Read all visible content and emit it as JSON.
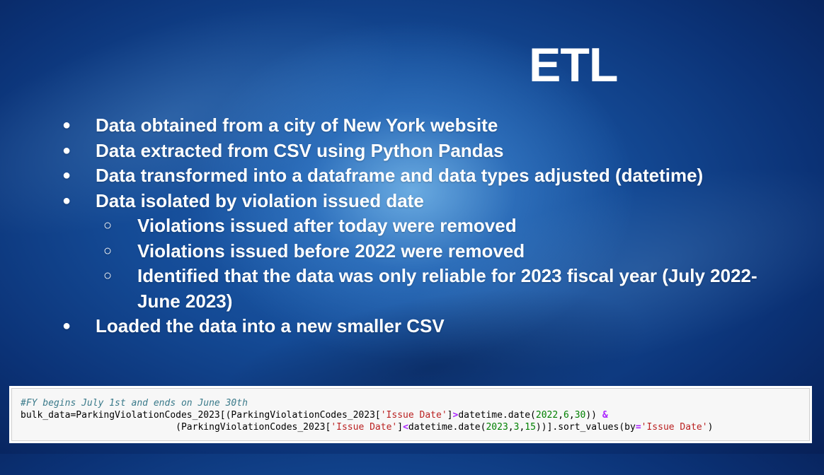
{
  "slide": {
    "title": "ETL",
    "bullets": [
      {
        "level": 1,
        "marker": "●",
        "text": "Data obtained from a city of New York website"
      },
      {
        "level": 1,
        "marker": "●",
        "text": "Data extracted from CSV using Python Pandas"
      },
      {
        "level": 1,
        "marker": "●",
        "text": "Data transformed into a dataframe and data types adjusted (datetime)"
      },
      {
        "level": 1,
        "marker": "●",
        "text": "Data isolated by violation issued date"
      },
      {
        "level": 2,
        "marker": "○",
        "text": "Violations issued after today were removed"
      },
      {
        "level": 2,
        "marker": "○",
        "text": "Violations issued before 2022 were removed"
      },
      {
        "level": 2,
        "marker": "○",
        "text": "Identified that the data was only reliable for 2023 fiscal year (July 2022-June 2023)"
      },
      {
        "level": 1,
        "marker": "●",
        "text": "Loaded the data into a new smaller CSV"
      }
    ]
  },
  "code": {
    "comment": "#FY begins July 1st and ends on June 30th",
    "line2": {
      "p1": "bulk_data=ParkingViolationCodes_2023[(ParkingViolationCodes_2023[",
      "s1": "'Issue Date'",
      "p2": "]",
      "op1": ">",
      "p3": "datetime.date(",
      "n1": "2022",
      "c1": ",",
      "n2": "6",
      "c2": ",",
      "n3": "30",
      "p4": ")) ",
      "op2": "&"
    },
    "line3": {
      "indent": "                            ",
      "p1": "(ParkingViolationCodes_2023[",
      "s1": "'Issue Date'",
      "p2": "]",
      "op1": "<",
      "p3": "datetime.date(",
      "n1": "2023",
      "c1": ",",
      "n2": "3",
      "c2": ",",
      "n3": "15",
      "p4": "))].sort_values(by",
      "op2": "=",
      "s2": "'Issue Date'",
      "p5": ")"
    }
  },
  "colors": {
    "background": "#0a2a66",
    "text": "#ffffff",
    "code_comment": "#3a7a8a",
    "code_string": "#ba2121",
    "code_number": "#008000",
    "code_operator": "#aa22ff"
  }
}
